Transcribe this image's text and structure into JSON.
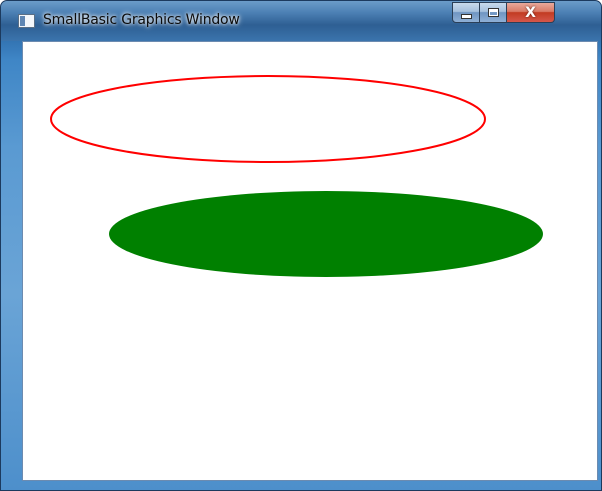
{
  "window": {
    "title": "SmallBasic Graphics Window",
    "icon": "smallbasic-app-icon",
    "controls": {
      "minimize": "minimize-icon",
      "maximize": "maximize-icon",
      "close_label": "X"
    }
  },
  "canvas": {
    "background": "#ffffff",
    "shapes": [
      {
        "type": "ellipse",
        "fill": "none",
        "stroke": "#ff0000"
      },
      {
        "type": "ellipse",
        "fill": "#008000",
        "stroke": "none"
      }
    ]
  }
}
